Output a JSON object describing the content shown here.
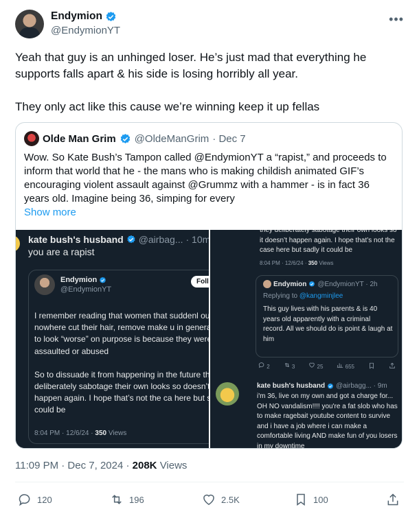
{
  "author": {
    "name": "Endymion",
    "handle": "@EndymionYT"
  },
  "more_glyph": "•••",
  "tweet": {
    "paragraph1": "Yeah that guy is an unhinged loser. He’s just mad that everything he supports falls apart & his side is losing horribly all year.",
    "paragraph2": "They only act like this cause we’re winning keep it up fellas"
  },
  "quote": {
    "name": "Olde Man Grim",
    "handle": "@OldeManGrim",
    "date": "· Dec 7",
    "text": "Wow. So Kate Bush’s Tampon called @EndymionYT a “rapist,” and proceeds to inform that world that he - the mans who is making childish animated GIF’s encouraging violent assault against @Grummz with a hammer - is in fact 36 years old. Imagine being 36, simping for every",
    "show_more": "Show more"
  },
  "screenshot_left": {
    "name": "kate bush's husband",
    "handle": "@airbag...",
    "time": "· 10m",
    "reply": "you are a rapist",
    "inner": {
      "name": "Endymion",
      "handle": "@EndymionYT",
      "follow": "Follo",
      "p1": "I remember reading that women that suddenl out of nowhere cut their hair, remove make u in general try to look “worse” on purpose is because they were likely assaulted or abused",
      "p2": "So to dissuade it from happening in the future they deliberately sabotage their own looks so doesn’t happen again. I hope that’s not the ca here but sadly it could be",
      "meta_time": "8:04 PM · 12/6/24 ·",
      "meta_views_count": "350",
      "meta_views_label": "Views"
    }
  },
  "screenshot_right": {
    "top_text": "they deliberately sabotage their own looks so it doesn’t happen again. I hope that’s not the case here but sadly it could be",
    "top_meta_time": "8:04 PM · 12/6/24 ·",
    "top_meta_count": "350",
    "top_meta_label": "Views",
    "card": {
      "name": "Endymion",
      "handle": "@EndymionYT · 2h",
      "replying_to": "Replying to",
      "replying_handle": "@kangminjlee",
      "text": "This guy lives with his parents & is 40 years old apparently with a criminal record. All we should do is point & laugh at him"
    },
    "actions": {
      "replies": "2",
      "reposts": "3",
      "likes": "25",
      "views": "655"
    },
    "reply2": {
      "name": "kate bush's husband",
      "handle": "@airbagg... · 9m",
      "text": "i'm 36, live on my own and got a charge for... OH NO vandalism!!!! you're a fat slob who has to make ragebait youtube content to survive and i have a job where i can make a comfortable living AND make fun of you losers in my downtime"
    }
  },
  "timestamp": {
    "time": "11:09 PM · Dec 7, 2024 ·",
    "views_count": "208K",
    "views_label": "Views"
  },
  "stats": {
    "replies": "120",
    "reposts": "196",
    "likes": "2.5K",
    "bookmarks": "100"
  },
  "colors": {
    "accent": "#1d9bf0",
    "dark_bg": "#15202b",
    "muted": "#536471"
  }
}
